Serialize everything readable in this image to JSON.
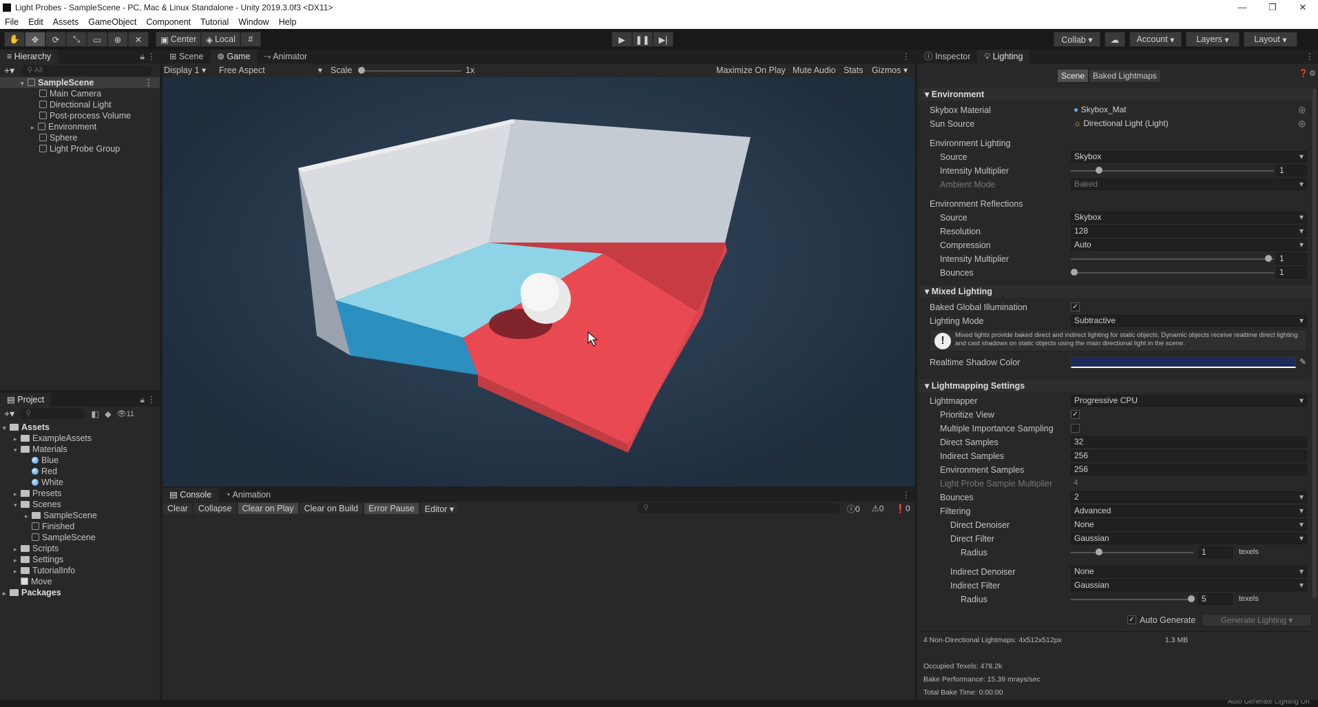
{
  "window": {
    "title": "Light Probes - SampleScene - PC, Mac & Linux Standalone - Unity 2019.3.0f3 <DX11>"
  },
  "menu": [
    "File",
    "Edit",
    "Assets",
    "GameObject",
    "Component",
    "Tutorial",
    "Window",
    "Help"
  ],
  "toolbar": {
    "center": "Center",
    "local": "Local",
    "collab": "Collab ▾",
    "account": "Account",
    "layers": "Layers",
    "layout": "Layout"
  },
  "hierarchy": {
    "tab": "Hierarchy",
    "search": "All",
    "scene": "SampleScene",
    "items": [
      "Main Camera",
      "Directional Light",
      "Post-process Volume",
      "Environment",
      "Sphere",
      "Light Probe Group"
    ]
  },
  "project": {
    "tab": "Project",
    "count": "11",
    "root": "Assets",
    "tree": [
      {
        "label": "ExampleAssets",
        "kind": "folder",
        "depth": 1,
        "arrow": "▸"
      },
      {
        "label": "Materials",
        "kind": "folder",
        "depth": 1,
        "arrow": "▾"
      },
      {
        "label": "Blue",
        "kind": "mat",
        "depth": 2,
        "arrow": ""
      },
      {
        "label": "Red",
        "kind": "mat",
        "depth": 2,
        "arrow": ""
      },
      {
        "label": "White",
        "kind": "mat",
        "depth": 2,
        "arrow": ""
      },
      {
        "label": "Presets",
        "kind": "folder",
        "depth": 1,
        "arrow": "▸"
      },
      {
        "label": "Scenes",
        "kind": "folder",
        "depth": 1,
        "arrow": "▾"
      },
      {
        "label": "SampleScene",
        "kind": "folder",
        "depth": 2,
        "arrow": "▸"
      },
      {
        "label": "Finished",
        "kind": "scene",
        "depth": 2,
        "arrow": ""
      },
      {
        "label": "SampleScene",
        "kind": "scene",
        "depth": 2,
        "arrow": ""
      },
      {
        "label": "Scripts",
        "kind": "folder",
        "depth": 1,
        "arrow": "▸"
      },
      {
        "label": "Settings",
        "kind": "folder",
        "depth": 1,
        "arrow": "▸"
      },
      {
        "label": "TutorialInfo",
        "kind": "folder",
        "depth": 1,
        "arrow": "▸"
      },
      {
        "label": "Move",
        "kind": "file",
        "depth": 1,
        "arrow": ""
      }
    ],
    "packages": "Packages"
  },
  "game": {
    "tabs": [
      "Scene",
      "Game",
      "Animator"
    ],
    "display": "Display 1",
    "aspect": "Free Aspect",
    "scale_label": "Scale",
    "scale_value": "1x",
    "maximize": "Maximize On Play",
    "mute": "Mute Audio",
    "stats": "Stats",
    "gizmos": "Gizmos"
  },
  "console": {
    "tabs": [
      "Console",
      "Animation"
    ],
    "buttons": [
      "Clear",
      "Collapse",
      "Clear on Play",
      "Clear on Build",
      "Error Pause",
      "Editor ▾"
    ],
    "counts": [
      "0",
      "0",
      "0"
    ]
  },
  "inspector": {
    "tabs": [
      "Inspector",
      "Lighting"
    ],
    "subtabs": [
      "Scene",
      "Baked Lightmaps"
    ],
    "environment": "Environment",
    "skybox_label": "Skybox Material",
    "skybox_value": "Skybox_Mat",
    "sun_label": "Sun Source",
    "sun_value": "Directional Light (Light)",
    "env_lighting": "Environment Lighting",
    "source_label": "Source",
    "source_value": "Skybox",
    "intensity_label": "Intensity Multiplier",
    "intensity_value": "1",
    "ambient_label": "Ambient Mode",
    "ambient_value": "Baked",
    "env_reflections": "Environment Reflections",
    "r_source_value": "Skybox",
    "resolution_label": "Resolution",
    "resolution_value": "128",
    "compression_label": "Compression",
    "compression_value": "Auto",
    "r_intensity_value": "1",
    "bounces_label": "Bounces",
    "r_bounces_value": "1",
    "mixed": "Mixed Lighting",
    "bgi_label": "Baked Global Illumination",
    "mode_label": "Lighting Mode",
    "mode_value": "Subtractive",
    "info": "Mixed lights provide baked direct and indirect lighting for static objects. Dynamic objects receive realtime direct lighting and cast shadows on static objects using the main directional light in the scene.",
    "shadow_label": "Realtime Shadow Color",
    "lm_settings": "Lightmapping Settings",
    "lightmapper_label": "Lightmapper",
    "lightmapper_value": "Progressive CPU",
    "prioritize_label": "Prioritize View",
    "mis_label": "Multiple Importance Sampling",
    "direct_samples_label": "Direct Samples",
    "direct_samples_value": "32",
    "indirect_samples_label": "Indirect Samples",
    "indirect_samples_value": "256",
    "env_samples_label": "Environment Samples",
    "env_samples_value": "256",
    "lpsm_label": "Light Probe Sample Multiplier",
    "lpsm_value": "4",
    "bounces_value": "2",
    "filtering_label": "Filtering",
    "filtering_value": "Advanced",
    "direct_denoiser_label": "Direct Denoiser",
    "direct_denoiser_value": "None",
    "direct_filter_label": "Direct Filter",
    "direct_filter_value": "Gaussian",
    "radius_label": "Radius",
    "radius1_value": "1",
    "texels": "texels",
    "indirect_denoiser_label": "Indirect Denoiser",
    "indirect_denoiser_value": "None",
    "indirect_filter_label": "Indirect Filter",
    "indirect_filter_value": "Gaussian",
    "radius2_value": "5",
    "auto_generate": "Auto Generate",
    "generate": "Generate Lighting",
    "stats1": "4 Non-Directional Lightmaps: 4x512x512px",
    "stats1_size": "1.3 MB",
    "stats2": "Occupied Texels: 478.2k",
    "stats3": "Bake Performance: 15.39 mrays/sec",
    "stats4": "Total Bake Time: 0:00:00"
  },
  "status": {
    "text": "Auto Generate Lighting On"
  },
  "colors": {
    "shadow": "#1b2b5a",
    "floor_blue": "#5bb8d4",
    "floor_red": "#e94a52",
    "viewport_bg": "#2b3a4c"
  }
}
